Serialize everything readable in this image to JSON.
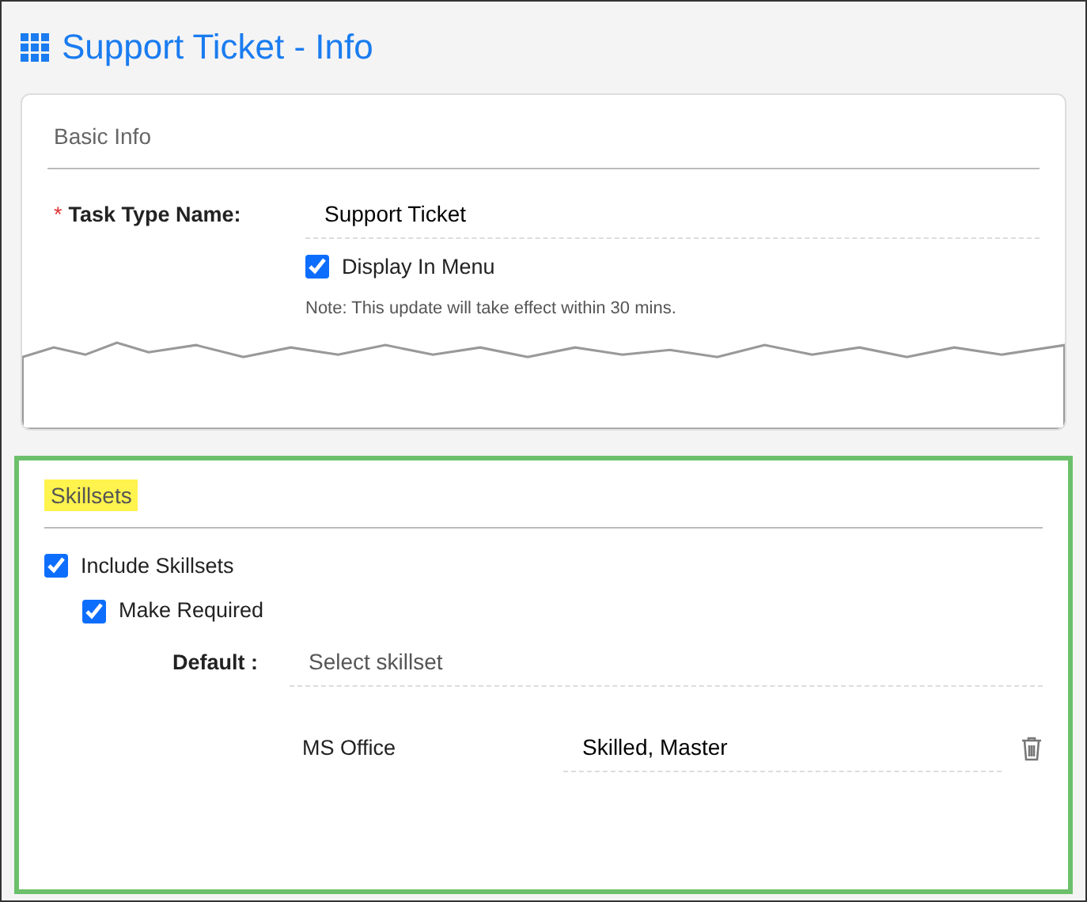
{
  "title": "Support Ticket - Info",
  "basic_info": {
    "heading": "Basic Info",
    "task_type": {
      "required_mark": "*",
      "label": "Task Type Name:",
      "value": "Support Ticket"
    },
    "display_in_menu": {
      "label": "Display In Menu",
      "checked": true
    },
    "note": "Note: This update will take effect within 30 mins."
  },
  "skillsets": {
    "heading": "Skillsets",
    "highlighted": true,
    "include": {
      "label": "Include Skillsets",
      "checked": true
    },
    "required": {
      "label": "Make Required",
      "checked": true
    },
    "default": {
      "label": "Default :",
      "placeholder": "Select skillset"
    },
    "rows": [
      {
        "name": "MS Office",
        "levels": "Skilled, Master"
      }
    ]
  }
}
